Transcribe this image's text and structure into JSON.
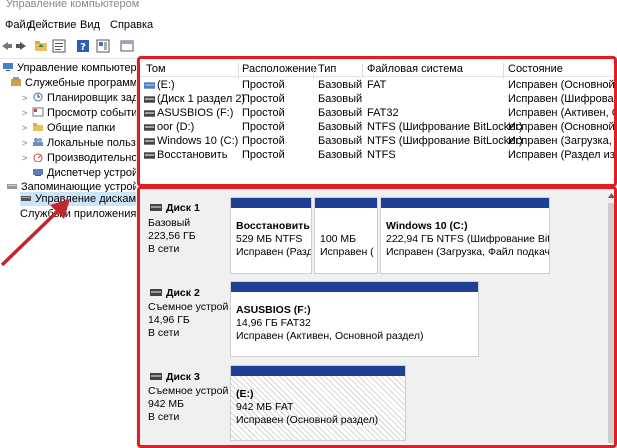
{
  "window": {
    "title": "Управление компьютером"
  },
  "menu": [
    "Файл",
    "Действие",
    "Вид",
    "Справка"
  ],
  "tree": {
    "root": "Управление компьютером (лс",
    "group1": "Служебные программы",
    "items1": [
      "Планировщик заданий",
      "Просмотр событий",
      "Общие папки",
      "Локальные пользовате",
      "Производительность",
      "Диспетчер устройств"
    ],
    "group2": "Запоминающие устройства",
    "disk_mgmt": "Управление дисками",
    "services": "Службы и приложения"
  },
  "volumes": {
    "columns": [
      "Том",
      "Расположение",
      "Тип",
      "Файловая система",
      "Состояние"
    ],
    "rows": [
      [
        "(E:)",
        "Простой",
        "Базовый",
        "FAT",
        "Исправен (Основной разд"
      ],
      [
        "(Диск 1 раздел 2)",
        "Простой",
        "Базовый",
        "",
        "Исправен (Шифрованны"
      ],
      [
        "ASUSBIOS (F:)",
        "Простой",
        "Базовый",
        "FAT32",
        "Исправен (Активен, Осн"
      ],
      [
        "oor (D:)",
        "Простой",
        "Базовый",
        "NTFS (Шифрование BitLocker)",
        "Исправен (Основной ра"
      ],
      [
        "Windows 10 (C:)",
        "Простой",
        "Базовый",
        "NTFS (Шифрование BitLocker)",
        "Исправен (Загрузка, Фа"
      ],
      [
        "Восстановить",
        "Простой",
        "Базовый",
        "NTFS",
        "Исправен (Раздел изгот"
      ]
    ]
  },
  "disks": [
    {
      "name": "Диск 1",
      "type": "Базовый",
      "size": "223,56 ГБ",
      "status": "В сети",
      "partitions": [
        {
          "name": "Восстановить",
          "size": "529 МБ NTFS",
          "status": "Исправен (Разде"
        },
        {
          "name": "",
          "size": "100 МБ",
          "status": "Исправен ("
        },
        {
          "name": "Windows 10  (C:)",
          "size": "222,94 ГБ NTFS (Шифрование BitLoc",
          "status": "Исправен (Загрузка, Файл подкач"
        }
      ]
    },
    {
      "name": "Диск 2",
      "type": "Съемное устрой",
      "size": "14,96 ГБ",
      "status": "В сети",
      "partitions": [
        {
          "name": "ASUSBIOS  (F:)",
          "size": "14,96 ГБ FAT32",
          "status": "Исправен (Активен, Основной раздел)"
        }
      ]
    },
    {
      "name": "Диск 3",
      "type": "Съемное устрой",
      "size": "942 МБ",
      "status": "В сети",
      "partitions": [
        {
          "name": "(E:)",
          "size": "942 МБ FAT",
          "status": "Исправен (Основной раздел)"
        }
      ]
    }
  ],
  "colors": {
    "highlight": "#e31b23",
    "partition_bar": "#1f3f94"
  },
  "icons": [
    "back-icon",
    "forward-icon",
    "up-folder-icon",
    "properties-icon",
    "help-icon",
    "view-icon",
    "console-icon",
    "disk-icon",
    "arrow-annotation"
  ]
}
